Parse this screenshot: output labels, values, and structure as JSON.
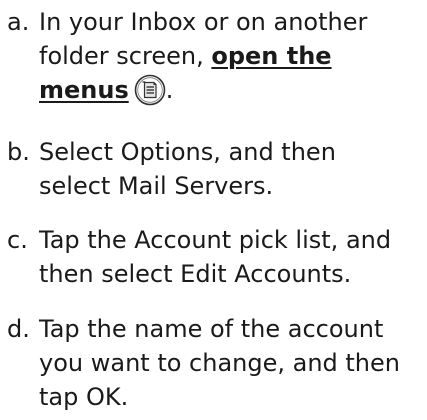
{
  "steps": [
    {
      "letter": "a.",
      "lines": [
        "In your Inbox or on another",
        "folder screen,"
      ],
      "link_line1": "open the",
      "link_line2": "menus",
      "after_icon": "."
    },
    {
      "letter": "b.",
      "lines": [
        "Select Options, and then",
        "select Mail Servers."
      ]
    },
    {
      "letter": "c.",
      "lines": [
        "Tap the Account pick list, and",
        "then select Edit Accounts."
      ]
    },
    {
      "letter": "d.",
      "lines": [
        "Tap the name of the account",
        "you want to change, and then",
        "tap OK."
      ]
    }
  ],
  "icons": {
    "menu": "menu-icon"
  }
}
